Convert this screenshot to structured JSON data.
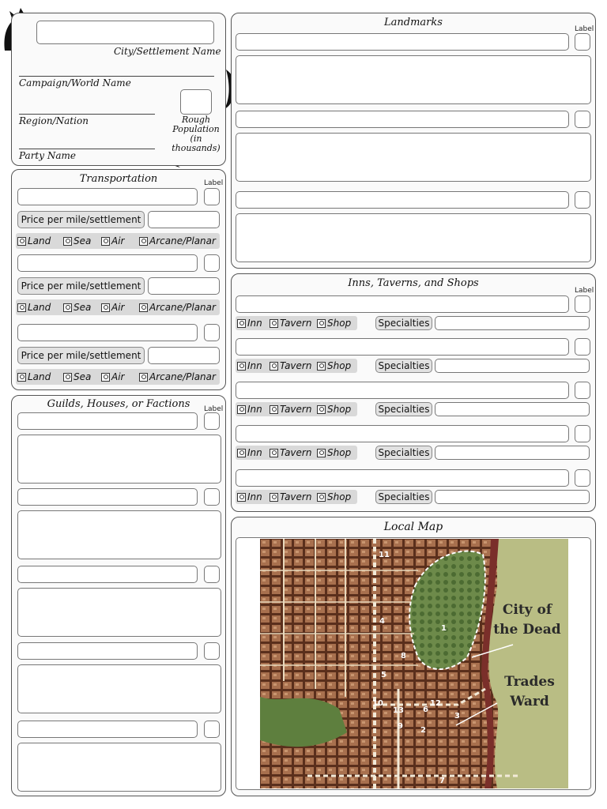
{
  "settlement": {
    "city_name_label": "City/Settlement Name",
    "campaign_label": "Campaign/World Name",
    "region_label": "Region/Nation",
    "party_label": "Party Name",
    "population_label_1": "Rough",
    "population_label_2": "Population",
    "population_label_3": "(in",
    "population_label_4": "thousands)"
  },
  "transportation": {
    "title": "Transportation",
    "label_caption": "Label",
    "price_label": "Price per mile/settlement",
    "options": [
      "Land",
      "Sea",
      "Air",
      "Arcane/Planar"
    ]
  },
  "guilds": {
    "title": "Guilds, Houses, or Factions",
    "label_caption": "Label"
  },
  "landmarks": {
    "title": "Landmarks",
    "label_caption": "Label"
  },
  "inns": {
    "title": "Inns, Taverns, and Shops",
    "label_caption": "Label",
    "options": [
      "Inn",
      "Tavern",
      "Shop"
    ],
    "specialties_label": "Specialties"
  },
  "local_map": {
    "title": "Local Map",
    "region_1": "City of",
    "region_1b": "the Dead",
    "region_2": "Trades",
    "region_2b": "Ward",
    "markers": [
      "11",
      "4",
      "1",
      "8",
      "5",
      "10",
      "13",
      "6",
      "12",
      "3",
      "9",
      "2",
      "7"
    ]
  }
}
